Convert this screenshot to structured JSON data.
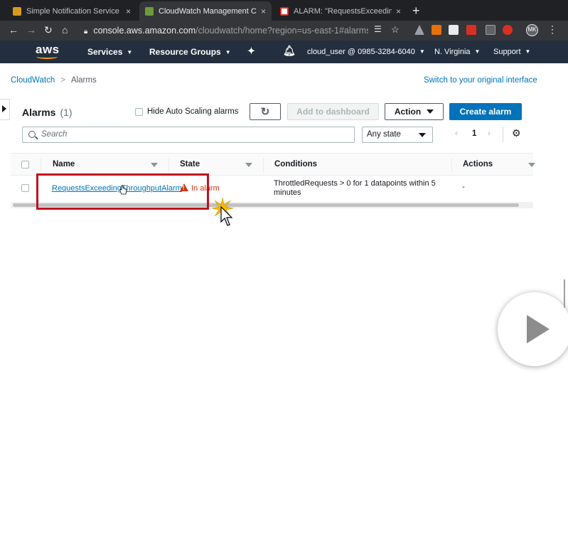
{
  "browser": {
    "tabs": [
      {
        "title": "Simple Notification Service",
        "favicon_color": "#d79b1c",
        "close": "×"
      },
      {
        "title": "CloudWatch Management Con",
        "favicon_color": "#6d9b3a",
        "close": "×"
      },
      {
        "title": "ALARM: \"RequestsExceeding",
        "favicon_color": "#d93025",
        "close": "×"
      }
    ],
    "new_tab": "+",
    "url_host": "console.aws.amazon.com",
    "url_path": "/cloudwatch/home?region=us-east-1#alarms...",
    "avatar_initials": "MK"
  },
  "aws_nav": {
    "logo": "aws",
    "services": "Services",
    "resource_groups": "Resource Groups",
    "account": "cloud_user @ 0985-3284-6040",
    "region": "N. Virginia",
    "support": "Support",
    "caret": "▼"
  },
  "breadcrumb": {
    "root": "CloudWatch",
    "separator": ">",
    "current": "Alarms"
  },
  "switch_link": "Switch to your original interface",
  "alarms_panel": {
    "title": "Alarms",
    "count": "(1)",
    "hide_autoscaling_label": "Hide Auto Scaling alarms",
    "refresh_icon": "↻",
    "add_to_dashboard": "Add to dashboard",
    "action": "Action",
    "create_alarm": "Create alarm",
    "search_placeholder": "Search",
    "state_filter": "Any state",
    "page_prev": "‹",
    "page_number": "1",
    "page_next": "›",
    "settings_icon": "⚙"
  },
  "table": {
    "columns": [
      "Name",
      "State",
      "Conditions",
      "Actions"
    ],
    "rows": [
      {
        "name": "RequestsExceedingThroughputAlarm",
        "state": "In alarm",
        "conditions": "ThrottledRequests > 0 for 1 datapoints within 5 minutes",
        "actions": "-"
      }
    ]
  },
  "colors": {
    "aws_navy": "#232f3e",
    "link_blue": "#0073bb",
    "alarm_red": "#d13212",
    "highlight_red": "#c1121f",
    "aws_orange": "#ff9900"
  }
}
